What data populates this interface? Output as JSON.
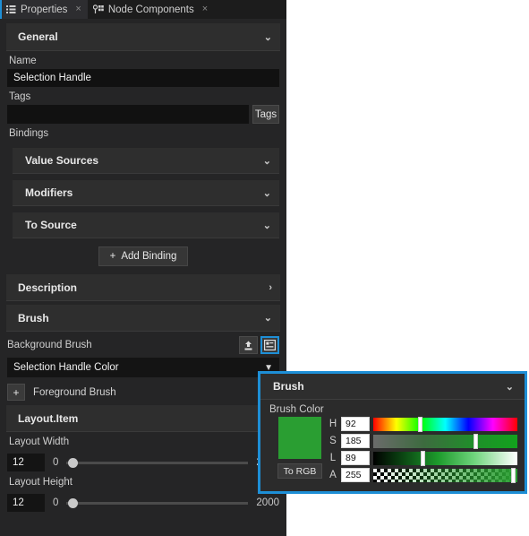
{
  "tabs": [
    {
      "label": "Properties",
      "icon": "list-icon",
      "close": "×",
      "active": true
    },
    {
      "label": "Node Components",
      "icon": "node-icon",
      "close": "×",
      "active": false
    }
  ],
  "sections": {
    "general": {
      "title": "General",
      "chevron": "⌄"
    },
    "description": {
      "title": "Description",
      "chevron": "›"
    },
    "brush": {
      "title": "Brush",
      "chevron": "⌄"
    },
    "layout_item": {
      "title": "Layout.Item"
    }
  },
  "name_field": {
    "label": "Name",
    "value": "Selection Handle"
  },
  "tags_field": {
    "label": "Tags",
    "value": "",
    "button_label": "Tags"
  },
  "bindings": {
    "label": "Bindings",
    "groups": [
      {
        "title": "Value Sources",
        "chevron": "⌄"
      },
      {
        "title": "Modifiers",
        "chevron": "⌄"
      },
      {
        "title": "To Source",
        "chevron": "⌄"
      }
    ],
    "add_button": {
      "plus": "+",
      "label": "Add Binding"
    }
  },
  "background_brush": {
    "label": "Background Brush",
    "upload_icon": "upload-icon",
    "panel_icon": "panel-icon",
    "value": "Selection Handle Color",
    "chevron": "▼"
  },
  "foreground_brush": {
    "plus": "+",
    "label": "Foreground Brush"
  },
  "layout_width": {
    "label": "Layout Width",
    "value": "12",
    "min": "0",
    "max": "2000",
    "knob_pct": 0.6
  },
  "layout_height": {
    "label": "Layout Height",
    "value": "12",
    "min": "0",
    "max": "2000",
    "knob_pct": 0.6
  },
  "popup": {
    "title": "Brush",
    "chevron": "⌄",
    "color_label": "Brush Color",
    "swatch_color": "#2a9e32",
    "to_rgb_label": "To RGB",
    "channels": [
      {
        "name": "H",
        "value": "92",
        "knob_pct": 32.0
      },
      {
        "name": "S",
        "value": "185",
        "knob_pct": 70.5
      },
      {
        "name": "L",
        "value": "89",
        "knob_pct": 34.0
      },
      {
        "name": "A",
        "value": "255",
        "knob_pct": 97.0
      }
    ]
  },
  "colors": {
    "accent": "#1e8fd6",
    "panel_bg": "#252526",
    "section_bg": "#2e2e2e",
    "input_bg": "#111111"
  }
}
